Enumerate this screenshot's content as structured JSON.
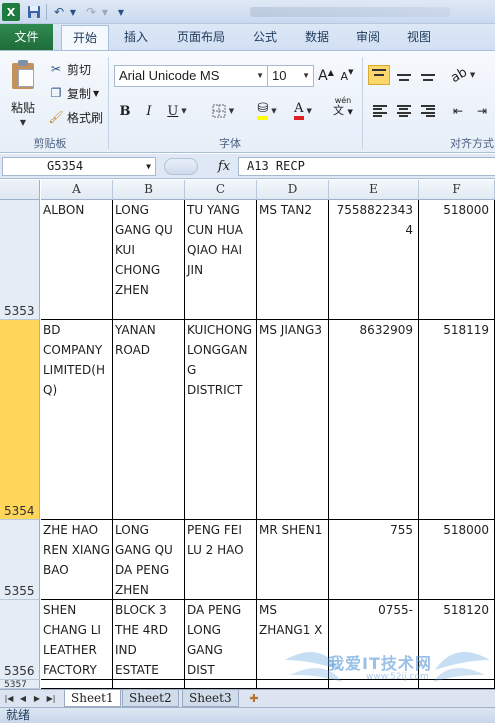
{
  "ribbon_tabs": [
    "文件",
    "开始",
    "插入",
    "页面布局",
    "公式",
    "数据",
    "审阅",
    "视图"
  ],
  "clipboard": {
    "paste_label": "粘贴",
    "cut_label": "剪切",
    "copy_label": "复制",
    "format_painter_label": "格式刷",
    "group_label": "剪贴板"
  },
  "font": {
    "name": "Arial Unicode MS",
    "size": "10",
    "group_label": "字体",
    "bold": "B",
    "italic": "I",
    "underline": "U",
    "grow": "A",
    "shrink": "A",
    "color_letter": "A",
    "phonetic": "wén"
  },
  "alignment": {
    "group_label": "对齐方式"
  },
  "formula_bar": {
    "name_box": "G5354",
    "fx": "fx",
    "formula": "A13 RECP"
  },
  "columns": [
    "A",
    "B",
    "C",
    "D",
    "E",
    "F"
  ],
  "rows": [
    {
      "num": "5353",
      "cells": [
        "ALBON",
        "LONG GANG QU KUI CHONG ZHEN",
        "TU YANG CUN HUA QIAO HAI JIN",
        "MS TAN2",
        "75588223434",
        "518000"
      ]
    },
    {
      "num": "5354",
      "cells": [
        "BD COMPANY LIMITED(HQ)",
        "YANAN ROAD",
        "KUICHONG LONGGANG DISTRICT",
        "MS JIANG3",
        "8632909",
        "518119"
      ]
    },
    {
      "num": "5355",
      "cells": [
        "ZHE HAO REN XIANG BAO",
        "LONG GANG QU DA PENG ZHEN",
        "PENG FEI LU 2 HAO",
        "MR SHEN1",
        "755",
        "518000"
      ]
    },
    {
      "num": "5356",
      "cells": [
        "SHEN CHANG LI LEATHER FACTORY",
        "BLOCK 3 THE 4RD IND ESTATE",
        "DA PENG LONG GANG DIST",
        "MS ZHANG1 X",
        "0755-",
        "518120"
      ]
    },
    {
      "num": "5357",
      "cells": [
        "",
        "",
        "",
        "",
        "",
        ""
      ]
    }
  ],
  "sheets": [
    "Sheet1",
    "Sheet2",
    "Sheet3"
  ],
  "status": "就绪",
  "watermark": {
    "text": "我爱IT技术网",
    "sub": "www.52ij.com"
  }
}
